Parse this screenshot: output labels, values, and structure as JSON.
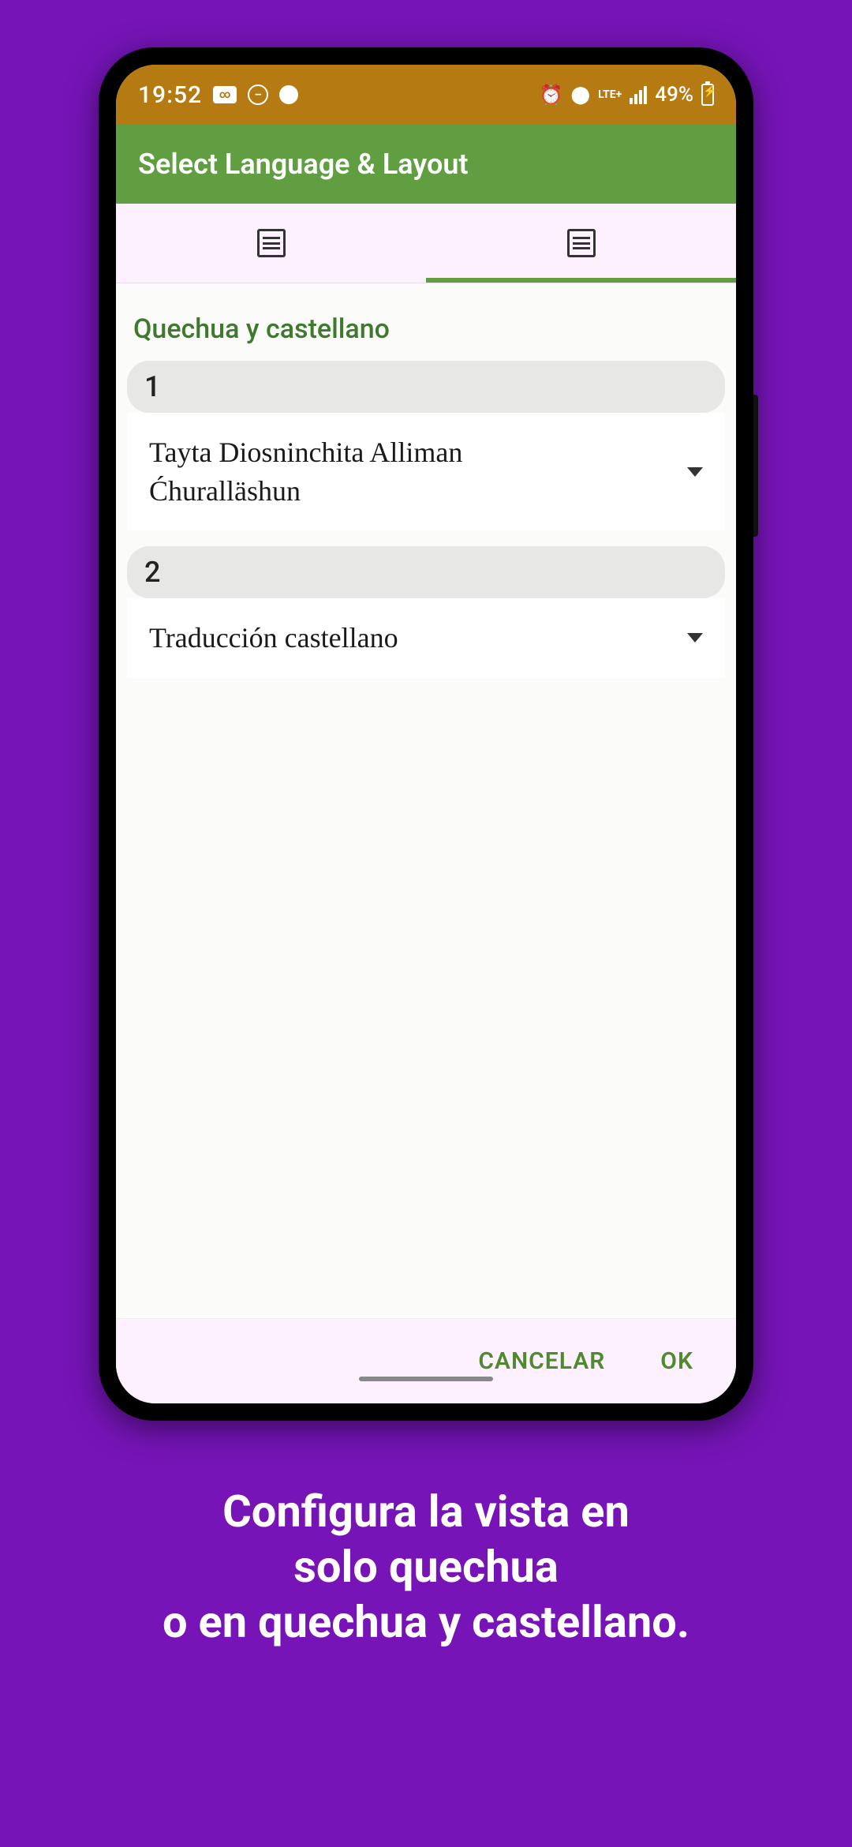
{
  "status": {
    "time": "19:52",
    "lte": "LTE+",
    "battery_text": "49%"
  },
  "header": {
    "title": "Select Language & Layout"
  },
  "section": {
    "title": "Quechua y castellano"
  },
  "rows": [
    {
      "number": "1",
      "value": "Tayta Diosninchita Alliman Ćhuralläshun"
    },
    {
      "number": "2",
      "value": "Traducción castellano"
    }
  ],
  "footer": {
    "cancel": "CANCELAR",
    "ok": "OK"
  },
  "caption": {
    "line1": "Configura la vista en",
    "line2": "solo quechua",
    "line3": "o en quechua y castellano."
  }
}
